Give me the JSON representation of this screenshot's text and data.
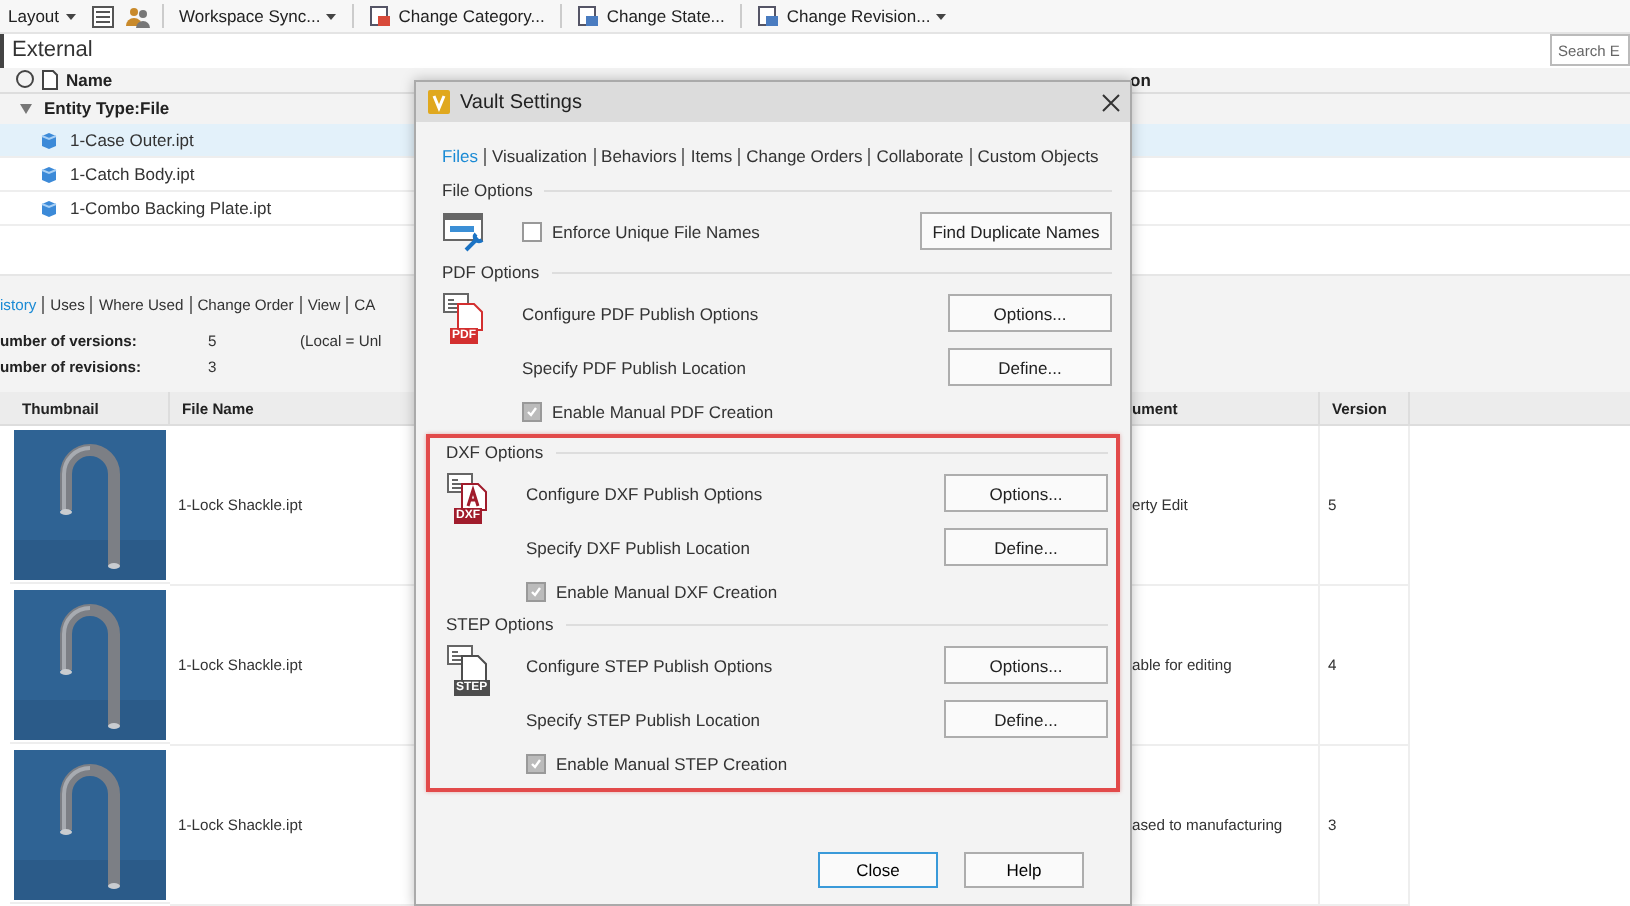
{
  "toolbar": {
    "items": [
      {
        "kind": "dropdown",
        "label": "Layout"
      },
      {
        "kind": "icon"
      },
      {
        "kind": "icon"
      },
      {
        "kind": "split",
        "label": "Workspace Sync..."
      },
      {
        "kind": "button",
        "label": "Change Category..."
      },
      {
        "kind": "button",
        "label": "Change State..."
      },
      {
        "kind": "split",
        "label": "Change Revision..."
      }
    ]
  },
  "header": {
    "title": "External",
    "search": {
      "placeholder": "Search E"
    }
  },
  "grid": {
    "columns": [
      "Name",
      "on"
    ],
    "group": {
      "label": "Entity Type:File",
      "expanded": true
    },
    "rows": [
      {
        "name": "1-Case Outer.ipt",
        "selected": true
      },
      {
        "name": "1-Catch Body.ipt",
        "selected": false
      },
      {
        "name": "1-Combo Backing Plate.ipt",
        "selected": false
      }
    ]
  },
  "details": {
    "tabs": [
      {
        "label": "istory",
        "selected": true
      },
      {
        "label": "Uses",
        "selected": false
      },
      {
        "label": "Where Used",
        "selected": false
      },
      {
        "label": "Change Order",
        "selected": false
      },
      {
        "label": "View",
        "selected": false
      },
      {
        "label": "CA",
        "selected": false
      }
    ],
    "info": [
      {
        "label": "umber of versions:",
        "value": "5",
        "note": "(Local = Unl"
      },
      {
        "label": "umber of revisions:",
        "value": "3"
      }
    ],
    "table": {
      "columns": [
        "Thumbnail",
        "File Name",
        "ument",
        "Version"
      ],
      "rows": [
        {
          "file_name": "1-Lock Shackle.ipt",
          "comment": "erty Edit",
          "version": "5"
        },
        {
          "file_name": "1-Lock Shackle.ipt",
          "comment": "able for editing",
          "version": "4"
        },
        {
          "file_name": "1-Lock Shackle.ipt",
          "comment": "ased to manufacturing",
          "version": "3"
        }
      ]
    }
  },
  "dialog": {
    "title": "Vault Settings",
    "tabs": [
      {
        "label": "Files",
        "selected": true
      },
      {
        "label": "Visualization",
        "selected": false
      },
      {
        "label": "Behaviors",
        "selected": false
      },
      {
        "label": "Items",
        "selected": false
      },
      {
        "label": "Change Orders",
        "selected": false
      },
      {
        "label": "Collaborate",
        "selected": false
      },
      {
        "label": "Custom Objects",
        "selected": false
      }
    ],
    "sections": [
      {
        "title": "File Options",
        "highlighted": false,
        "rows": [
          {
            "kind": "check",
            "label": "Enforce Unique File Names",
            "checked": false,
            "button": "Find Duplicate Names"
          }
        ]
      },
      {
        "title": "PDF Options",
        "badge": "PDF",
        "color": "#d32f2f",
        "highlighted": false,
        "rows": [
          {
            "kind": "action",
            "label": "Configure PDF Publish Options",
            "button": "Options..."
          },
          {
            "kind": "action",
            "label": "Specify PDF Publish Location",
            "button": "Define..."
          },
          {
            "kind": "check",
            "label": "Enable Manual PDF Creation",
            "checked": true
          }
        ]
      },
      {
        "title": "DXF Options",
        "badge": "DXF",
        "color": "#a01c2c",
        "highlighted": true,
        "rows": [
          {
            "kind": "action",
            "label": "Configure DXF Publish Options",
            "button": "Options..."
          },
          {
            "kind": "action",
            "label": "Specify DXF Publish Location",
            "button": "Define..."
          },
          {
            "kind": "check",
            "label": "Enable Manual DXF Creation",
            "checked": true
          }
        ]
      },
      {
        "title": "STEP Options",
        "badge": "STEP",
        "color": "#4d4d4d",
        "highlighted": true,
        "rows": [
          {
            "kind": "action",
            "label": "Configure STEP Publish Options",
            "button": "Options..."
          },
          {
            "kind": "action",
            "label": "Specify STEP Publish Location",
            "button": "Define..."
          },
          {
            "kind": "check",
            "label": "Enable Manual STEP Creation",
            "checked": true
          }
        ]
      }
    ],
    "buttons": [
      {
        "label": "Close",
        "default": true
      },
      {
        "label": "Help",
        "default": false
      }
    ]
  }
}
